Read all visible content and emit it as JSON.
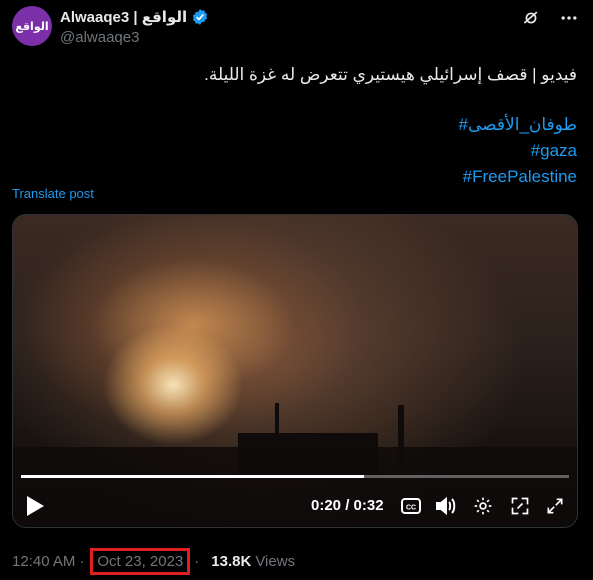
{
  "author": {
    "avatar_text": "الواقع",
    "display_name": "Alwaaqe3 | الواقع",
    "handle": "@alwaaqe3"
  },
  "tweet": {
    "text": "فيديو | قصف إسرائيلي هيستيري تتعرض له غزة الليلة.",
    "hashtags": [
      "#طوفان_الأقصى",
      "#gaza",
      "#FreePalestine"
    ],
    "translate_label": "Translate post"
  },
  "video": {
    "current_time": "0:20",
    "duration": "0:32",
    "time_display": "0:20 / 0:32",
    "progress": 0.625
  },
  "meta": {
    "time": "12:40 AM",
    "separator": "·",
    "date": "Oct 23, 2023",
    "views_count": "13.8K",
    "views_label": "Views"
  },
  "colors": {
    "accent": "#1d9bf0",
    "highlight_box": "#e0201e"
  }
}
